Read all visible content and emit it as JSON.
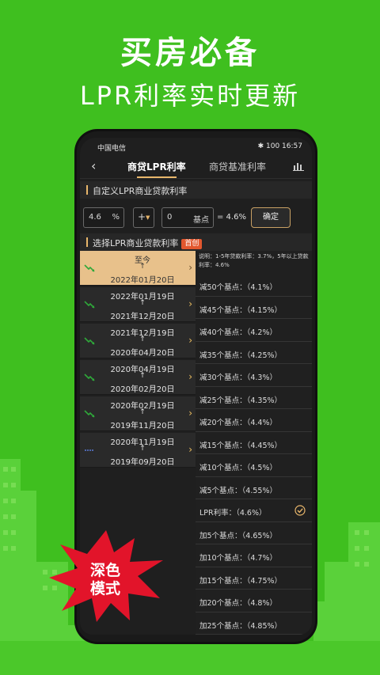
{
  "banner": {
    "title": "买房必备",
    "subtitle": "LPR利率实时更新"
  },
  "status_bar": {
    "carrier": "中国电信",
    "right": "✱ 100 16:57"
  },
  "nav": {
    "tabs": [
      {
        "label": "商贷LPR利率",
        "active": true
      },
      {
        "label": "商贷基准利率",
        "active": false
      }
    ]
  },
  "custom_section": {
    "title": "自定义LPR商业贷款利率"
  },
  "inputs": {
    "rate_value": "4.6",
    "rate_unit": "%",
    "operator": "+",
    "bp_value": "0",
    "bp_unit": "基点",
    "result": "= 4.6%",
    "confirm_label": "确定"
  },
  "select_section": {
    "title": "选择LPR商业贷款利率",
    "badge": "首创"
  },
  "periods": [
    {
      "line1": "至今",
      "arrow": "↑",
      "line2": "2022年01月20日",
      "selected": true,
      "trend": "down"
    },
    {
      "line1": "2022年01月19日",
      "arrow": "↑",
      "line2": "2021年12月20日",
      "selected": false,
      "trend": "down"
    },
    {
      "line1": "2021年12月19日",
      "arrow": "↑",
      "line2": "2020年04月20日",
      "selected": false,
      "trend": "down"
    },
    {
      "line1": "2020年04月19日",
      "arrow": "↑",
      "line2": "2020年02月20日",
      "selected": false,
      "trend": "down"
    },
    {
      "line1": "2020年02月19日",
      "arrow": "↑",
      "line2": "2019年11月20日",
      "selected": false,
      "trend": "down"
    },
    {
      "line1": "2020年11月19日",
      "arrow": "↑",
      "line2": "2019年09月20日",
      "selected": false,
      "trend": "flat"
    }
  ],
  "note": "说明：1-5年贷款利率：3.7%，5年以上贷款利率：4.6%",
  "options": [
    {
      "label": "减50个基点：（4.1%）"
    },
    {
      "label": "减45个基点：（4.15%）"
    },
    {
      "label": "减40个基点：（4.2%）"
    },
    {
      "label": "减35个基点：（4.25%）"
    },
    {
      "label": "减30个基点：（4.3%）"
    },
    {
      "label": "减25个基点：（4.35%）"
    },
    {
      "label": "减20个基点：（4.4%）"
    },
    {
      "label": "减15个基点：（4.45%）"
    },
    {
      "label": "减10个基点：（4.5%）"
    },
    {
      "label": "减5个基点：（4.55%）"
    },
    {
      "label": "LPR利率：（4.6%）",
      "checked": true
    },
    {
      "label": "加5个基点：（4.65%）"
    },
    {
      "label": "加10个基点：（4.7%）"
    },
    {
      "label": "加15个基点：（4.75%）"
    },
    {
      "label": "加20个基点：（4.8%）"
    },
    {
      "label": "加25个基点：（4.85%）"
    }
  ],
  "stamp": {
    "line1": "深色",
    "line2": "模式"
  },
  "colors": {
    "background": "#3fbf1f",
    "accent": "#e8b66b",
    "selected_period": "#e8c18b",
    "badge": "#e2572e",
    "stamp": "#e2142a"
  }
}
